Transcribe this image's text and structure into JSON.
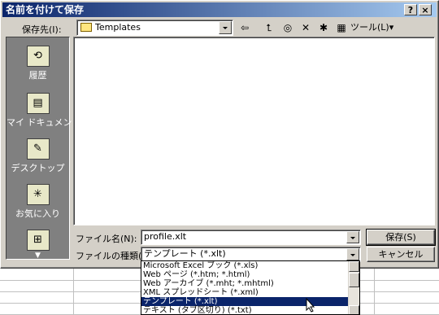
{
  "dialog": {
    "title": "名前を付けて保存",
    "help_button": "?",
    "close_button": "×"
  },
  "location": {
    "label": "保存先(I):",
    "value": "Templates",
    "icon": "folder-icon"
  },
  "toolbar": {
    "back": "⇦",
    "up": "⮤",
    "search": "◎",
    "delete": "✕",
    "new_folder": "✱",
    "views": "▦",
    "tools_label": "ツール(L)"
  },
  "places": [
    {
      "label": "履歴",
      "icon": "history-icon",
      "glyph": "⟲"
    },
    {
      "label": "マイ ドキュメント",
      "icon": "my-documents-icon",
      "glyph": "▤"
    },
    {
      "label": "デスクトップ",
      "icon": "desktop-icon",
      "glyph": "✎"
    },
    {
      "label": "お気に入り",
      "icon": "favorites-icon",
      "glyph": "✳"
    },
    {
      "label": "",
      "icon": "network-places-icon",
      "glyph": "⊞"
    }
  ],
  "filename": {
    "label": "ファイル名(N):",
    "value": "profile.xlt"
  },
  "filetype": {
    "label": "ファイルの種類(T):",
    "value": "テンプレート (*.xlt)"
  },
  "buttons": {
    "save": "保存(S)",
    "cancel": "キャンセル"
  },
  "dropdown_options": [
    "Microsoft Excel ブック (*.xls)",
    "Web ページ (*.htm; *.html)",
    "Web アーカイブ (*.mht; *.mhtml)",
    "XML スプレッドシート (*.xml)",
    "テンプレート (*.xlt)",
    "テキスト (タブ区切り) (*.txt)"
  ],
  "dropdown_selected_index": 4
}
